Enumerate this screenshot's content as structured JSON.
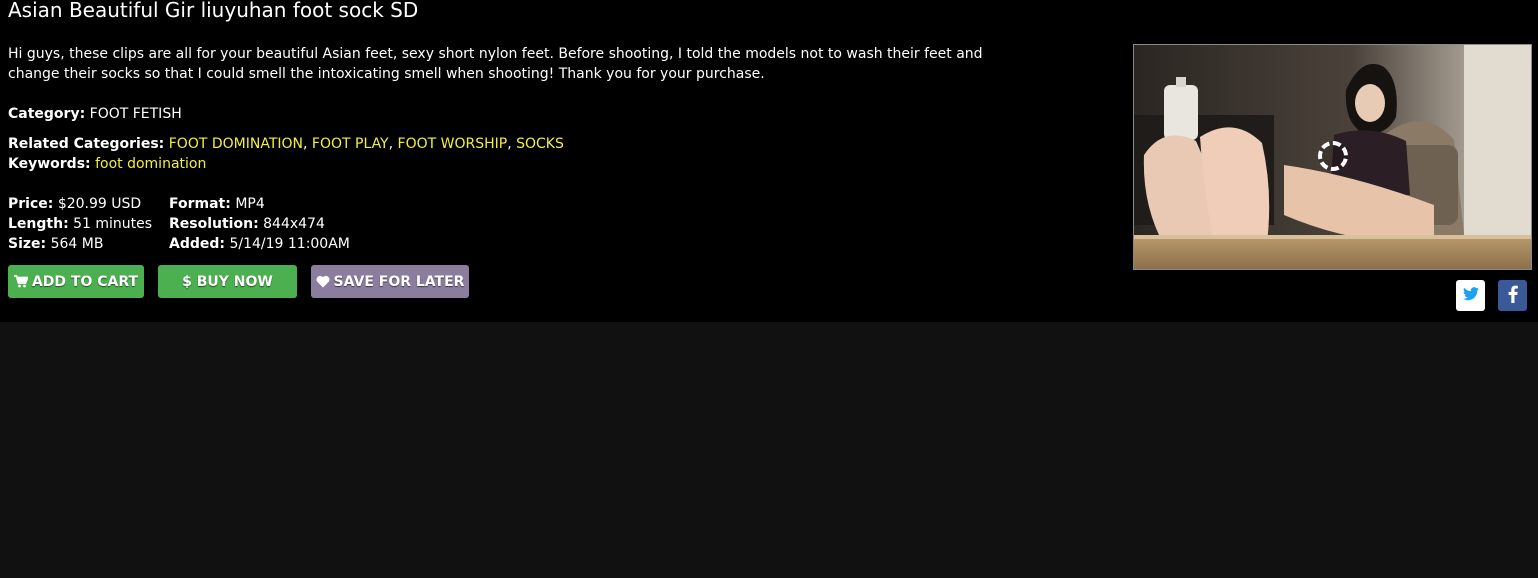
{
  "clip": {
    "title": "Asian Beautiful Gir liuyuhan foot sock SD",
    "description": "Hi guys, these clips are all for your beautiful Asian feet, sexy short nylon feet. Before shooting, I told the models not to wash their feet and change their socks so that I could smell the intoxicating smell when shooting! Thank you for your purchase."
  },
  "category": {
    "label": "Category:",
    "value": "FOOT FETISH"
  },
  "related": {
    "label": "Related Categories:",
    "items": [
      "FOOT DOMINATION",
      "FOOT PLAY",
      "FOOT WORSHIP",
      "SOCKS"
    ],
    "separator": ","
  },
  "keywords": {
    "label": "Keywords:",
    "items": [
      "foot domination"
    ]
  },
  "details": {
    "price_label": "Price:",
    "price": "$20.99 USD",
    "length_label": "Length:",
    "length": "51 minutes",
    "size_label": "Size:",
    "size": "564 MB",
    "format_label": "Format:",
    "format": "MP4",
    "resolution_label": "Resolution:",
    "resolution": "844x474",
    "added_label": "Added:",
    "added": "5/14/19 11:00AM"
  },
  "actions": {
    "add_to_cart": "ADD TO CART",
    "buy_now": "$ BUY NOW",
    "save_for_later": "SAVE FOR LATER"
  },
  "icons": {
    "cart": "shopping-cart-icon",
    "heart": "heart-icon",
    "twitter": "twitter-icon",
    "facebook": "facebook-icon",
    "play": "loading-ring-icon"
  },
  "colors": {
    "link_yellow": "#f4ef3f",
    "green_button": "#4caf50",
    "save_button": "#8a7d9e",
    "facebook_blue": "#3b5998",
    "twitter_blue": "#1da1f2"
  }
}
